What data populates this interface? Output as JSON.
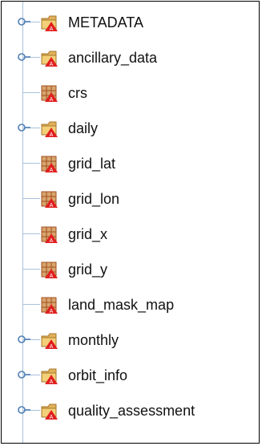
{
  "tree": {
    "colors": {
      "connector": "#a9c2dc",
      "expander": "#4f7fb5",
      "folder": "#e0b15a",
      "dataset": "#a24e21",
      "badge": "#e11e1e"
    },
    "items": [
      {
        "label": "METADATA",
        "type": "group",
        "icon": "folder-icon"
      },
      {
        "label": "ancillary_data",
        "type": "group",
        "icon": "folder-icon"
      },
      {
        "label": "crs",
        "type": "dataset",
        "icon": "dataset-icon"
      },
      {
        "label": "daily",
        "type": "group",
        "icon": "folder-icon"
      },
      {
        "label": "grid_lat",
        "type": "dataset",
        "icon": "dataset-icon"
      },
      {
        "label": "grid_lon",
        "type": "dataset",
        "icon": "dataset-icon"
      },
      {
        "label": "grid_x",
        "type": "dataset",
        "icon": "dataset-icon"
      },
      {
        "label": "grid_y",
        "type": "dataset",
        "icon": "dataset-icon"
      },
      {
        "label": "land_mask_map",
        "type": "dataset",
        "icon": "dataset-icon"
      },
      {
        "label": "monthly",
        "type": "group",
        "icon": "folder-icon"
      },
      {
        "label": "orbit_info",
        "type": "group",
        "icon": "folder-icon"
      },
      {
        "label": "quality_assessment",
        "type": "group",
        "icon": "folder-icon"
      }
    ]
  }
}
